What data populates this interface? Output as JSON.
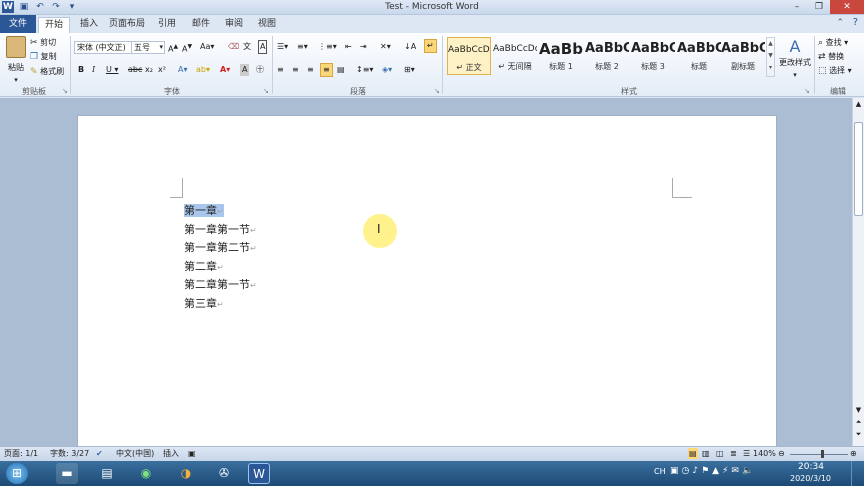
{
  "window": {
    "title": "Test - Microsoft Word"
  },
  "tabs": [
    "文件",
    "开始",
    "插入",
    "页面布局",
    "引用",
    "邮件",
    "审阅",
    "视图"
  ],
  "clipboard": {
    "paste": "粘贴",
    "cut": "剪切",
    "copy": "复制",
    "format_painter": "格式刷",
    "label": "剪贴板"
  },
  "font": {
    "name": "宋体 (中文正)",
    "size": "五号",
    "label": "字体"
  },
  "paragraph": {
    "label": "段落"
  },
  "styles": {
    "items": [
      {
        "sample": "AaBbCcDd",
        "name": "正文"
      },
      {
        "sample": "AaBbCcDd",
        "name": "无间隔"
      },
      {
        "sample": "AaBb",
        "name": "标题 1"
      },
      {
        "sample": "AaBbC",
        "name": "标题 2"
      },
      {
        "sample": "AaBbC",
        "name": "标题 3"
      },
      {
        "sample": "AaBbC",
        "name": "标题"
      },
      {
        "sample": "AaBbC",
        "name": "副标题"
      }
    ],
    "change": "更改样式",
    "label": "样式"
  },
  "editing": {
    "find": "查找",
    "replace": "替换",
    "select": "选择",
    "label": "编辑"
  },
  "document": {
    "lines": [
      "第一章",
      "第一章第一节",
      "第一章第二节",
      "第二章",
      "第二章第一节",
      "第三章"
    ],
    "para_mark": "↵"
  },
  "status": {
    "page": "页面: 1/1",
    "words": "字数: 3/27",
    "lang": "中文(中国)",
    "mode": "插入",
    "zoom": "140%"
  },
  "taskbar": {
    "lang": "CH",
    "time": "20:34",
    "date": "2020/3/10"
  }
}
